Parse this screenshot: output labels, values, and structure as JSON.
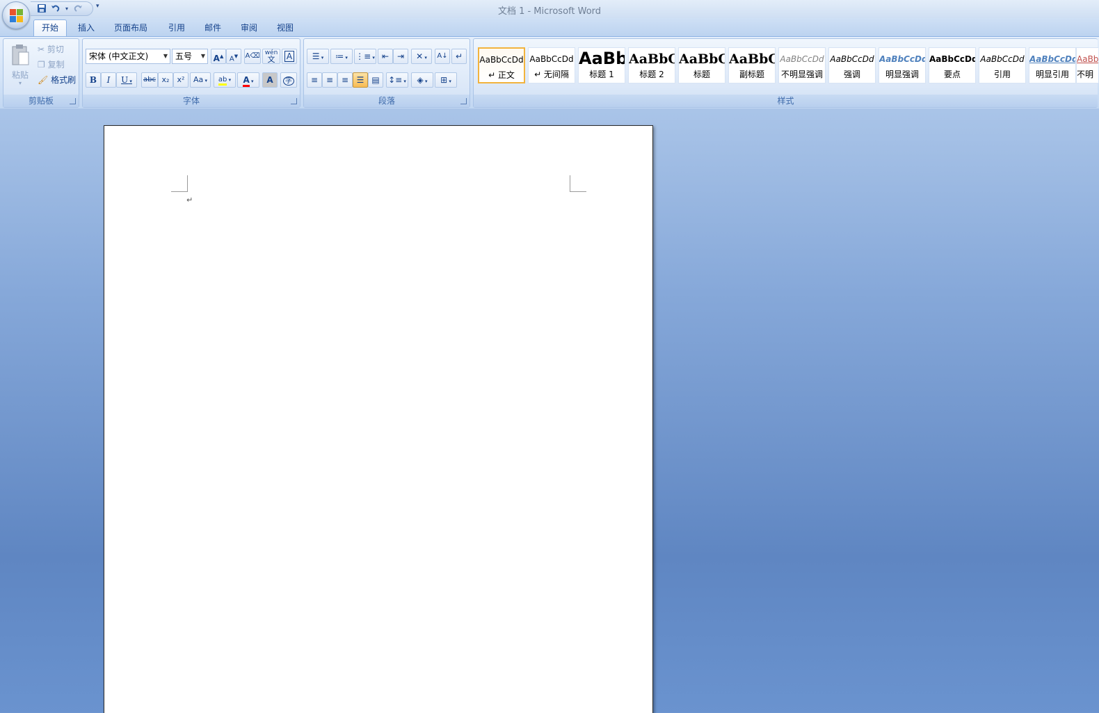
{
  "window": {
    "title": "文档 1 - Microsoft Word"
  },
  "quick_access": {
    "save_icon": "save-icon",
    "undo_icon": "undo-icon",
    "redo_icon": "redo-icon",
    "more": "▾"
  },
  "tabs": [
    {
      "label": "开始",
      "active": true
    },
    {
      "label": "插入"
    },
    {
      "label": "页面布局"
    },
    {
      "label": "引用"
    },
    {
      "label": "邮件"
    },
    {
      "label": "审阅"
    },
    {
      "label": "视图"
    }
  ],
  "clipboard": {
    "label": "剪贴板",
    "paste": "粘贴",
    "cut": "剪切",
    "copy": "复制",
    "format_painter": "格式刷"
  },
  "font": {
    "label": "字体",
    "name": "宋体 (中文正文)",
    "size": "五号",
    "grow": "A",
    "shrink": "A",
    "bold": "B",
    "italic": "I",
    "underline": "U",
    "strike": "abc",
    "subscript": "x₂",
    "superscript": "x²",
    "change_case": "Aa",
    "highlight": "ab",
    "font_color": "A",
    "char_shading": "A",
    "enclose": "字",
    "phonetic": "wén",
    "phonetic_char": "文",
    "border_char": "A"
  },
  "paragraph": {
    "label": "段落"
  },
  "styles": {
    "label": "样式",
    "items": [
      {
        "sample": "AaBbCcDd",
        "name": "↵ 正文",
        "selected": true
      },
      {
        "sample": "AaBbCcDd",
        "name": "↵ 无间隔"
      },
      {
        "sample": "AaBb",
        "name": "标题 1"
      },
      {
        "sample": "AaBbC",
        "name": "标题 2"
      },
      {
        "sample": "AaBbC",
        "name": "标题"
      },
      {
        "sample": "AaBbC",
        "name": "副标题"
      },
      {
        "sample": "AaBbCcDd",
        "name": "不明显强调"
      },
      {
        "sample": "AaBbCcDd",
        "name": "强调"
      },
      {
        "sample": "AaBbCcDd",
        "name": "明显强调"
      },
      {
        "sample": "AaBbCcDd",
        "name": "要点"
      },
      {
        "sample": "AaBbCcDd",
        "name": "引用"
      },
      {
        "sample": "AaBbCcDd",
        "name": "明显引用"
      },
      {
        "sample": "AaBb",
        "name": "不明"
      }
    ]
  },
  "document": {
    "paragraph_mark": "↵"
  },
  "colors": {
    "highlight": "#ffff00",
    "font_color": "#ff0000",
    "accent": "#15428b"
  }
}
